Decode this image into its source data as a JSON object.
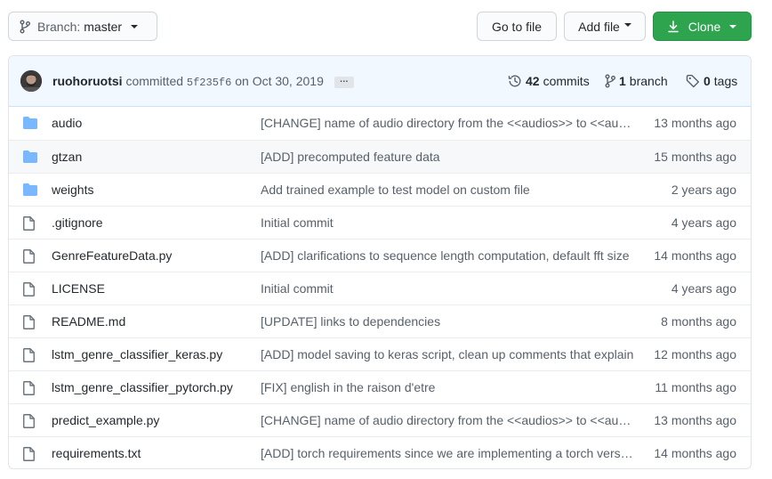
{
  "toolbar": {
    "branch_prefix": "Branch:",
    "branch_name": "master",
    "goto_label": "Go to file",
    "add_label": "Add file",
    "clone_label": "Clone"
  },
  "commit": {
    "author": "ruohoruotsi",
    "verb": "committed",
    "sha": "5f235f6",
    "on_label": "on",
    "date": "Oct 30, 2019",
    "ellipsis": "…"
  },
  "stats": {
    "commits_count": "42",
    "commits_label": "commits",
    "branches_count": "1",
    "branches_label": "branch",
    "tags_count": "0",
    "tags_label": "tags"
  },
  "files": [
    {
      "type": "dir",
      "name": "audio",
      "message": "[CHANGE] name of audio directory from the <<audios>> to <<audio>>",
      "age": "13 months ago"
    },
    {
      "type": "dir",
      "name": "gtzan",
      "message": "[ADD] precomputed feature data",
      "age": "15 months ago"
    },
    {
      "type": "dir",
      "name": "weights",
      "message": "Add trained example to test model on custom file",
      "age": "2 years ago"
    },
    {
      "type": "file",
      "name": ".gitignore",
      "message": "Initial commit",
      "age": "4 years ago"
    },
    {
      "type": "file",
      "name": "GenreFeatureData.py",
      "message": "[ADD] clarifications to sequence length computation, default fft size",
      "age": "14 months ago"
    },
    {
      "type": "file",
      "name": "LICENSE",
      "message": "Initial commit",
      "age": "4 years ago"
    },
    {
      "type": "file",
      "name": "README.md",
      "message": "[UPDATE] links to dependencies",
      "age": "8 months ago"
    },
    {
      "type": "file",
      "name": "lstm_genre_classifier_keras.py",
      "message": "[ADD] model saving to keras script, clean up comments that explain",
      "age": "12 months ago"
    },
    {
      "type": "file",
      "name": "lstm_genre_classifier_pytorch.py",
      "message": "[FIX] english in the raison d'etre",
      "age": "11 months ago"
    },
    {
      "type": "file",
      "name": "predict_example.py",
      "message": "[CHANGE] name of audio directory from the <<audios>> to <<audio>>",
      "age": "13 months ago"
    },
    {
      "type": "file",
      "name": "requirements.txt",
      "message": "[ADD] torch requirements since we are implementing a torch version",
      "age": "14 months ago"
    }
  ],
  "colors": {
    "folder": "#79b8ff",
    "file_icon": "#6a737d",
    "clone_bg": "#2ea44f",
    "header_bg": "#f1f8ff"
  }
}
